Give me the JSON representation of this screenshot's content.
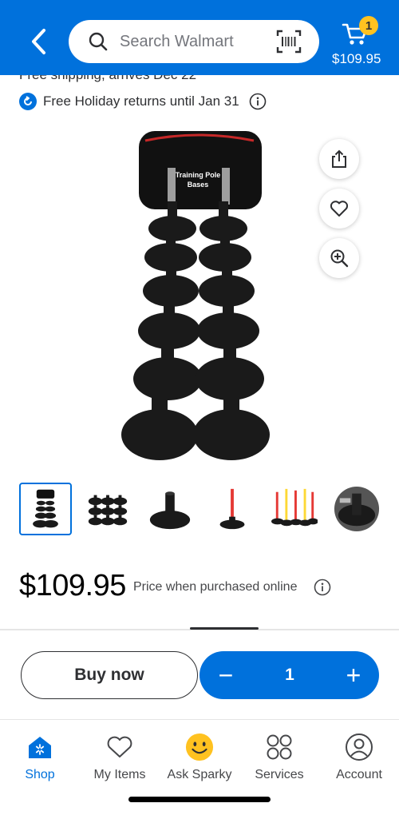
{
  "header": {
    "search_placeholder": "Search Walmart",
    "cart_count": "1",
    "cart_total": "$109.95",
    "accent": "#0071dc",
    "badge_color": "#ffc220"
  },
  "shipping": {
    "text": "Free shipping, arrives Dec 22",
    "returns_text": "Free Holiday returns until Jan 31"
  },
  "product": {
    "bag_label_line1": "Training Pole",
    "bag_label_line2": "Bases",
    "actions": [
      "share-icon",
      "heart-icon",
      "zoom-in-icon"
    ]
  },
  "gallery": {
    "selected_index": 0,
    "thumbnails": [
      "thumb-full-set",
      "thumb-bases-grid",
      "thumb-single-base",
      "thumb-pole-base",
      "thumb-colored-poles",
      "thumb-base-closeup"
    ]
  },
  "price": {
    "amount": "$109.95",
    "note": "Price when purchased online"
  },
  "purchase": {
    "buy_now_label": "Buy now",
    "minus": "−",
    "quantity": "1",
    "plus": "+"
  },
  "tabs": [
    {
      "label": "Shop",
      "icon": "shop-icon",
      "active": true
    },
    {
      "label": "My Items",
      "icon": "heart-icon",
      "active": false
    },
    {
      "label": "Ask Sparky",
      "icon": "sparky-icon",
      "active": false
    },
    {
      "label": "Services",
      "icon": "services-icon",
      "active": false
    },
    {
      "label": "Account",
      "icon": "account-icon",
      "active": false
    }
  ]
}
